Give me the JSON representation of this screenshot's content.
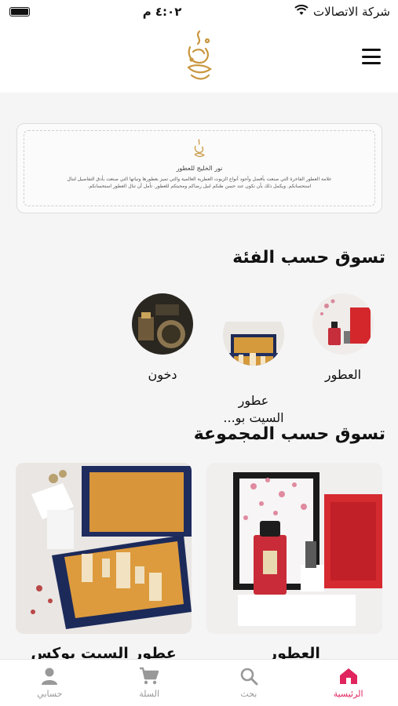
{
  "status": {
    "carrier": "شركة الاتصالات",
    "time": "٤:٠٢ م"
  },
  "colors": {
    "accent": "#e0245e",
    "brand_gold": "#c8963e"
  },
  "banner": {
    "title": "نور الخليج للعطور",
    "text": "علامة العطور الفاخرة التي صنعت بأفضل وأجود أنواع الزيوت العطرية العالمية والتي تميز بعطورها وتباتها التي صنعت بأدق التفاصيل لتنال استحسانكم. ويكمل ذلك بأن نكون عند حسن ظنكم لنيل رضاكم ومحبتكم للعطور. تأمل أن تنال العطور استحسانكم."
  },
  "sections": {
    "categories_title": "تسوق حسب الفئة",
    "collections_title": "تسوق حسب المجموعة"
  },
  "categories": [
    {
      "label": "العطور"
    },
    {
      "label": "عطور\nالسيت بو..."
    },
    {
      "label": "دخون"
    }
  ],
  "collections": [
    {
      "label": "العطور"
    },
    {
      "label": "عطور السيت بوكس"
    }
  ],
  "tabs": [
    {
      "label": "الرئيسية",
      "icon": "home-icon"
    },
    {
      "label": "بحث",
      "icon": "search-icon"
    },
    {
      "label": "السلة",
      "icon": "cart-icon"
    },
    {
      "label": "حسابي",
      "icon": "person-icon"
    }
  ]
}
